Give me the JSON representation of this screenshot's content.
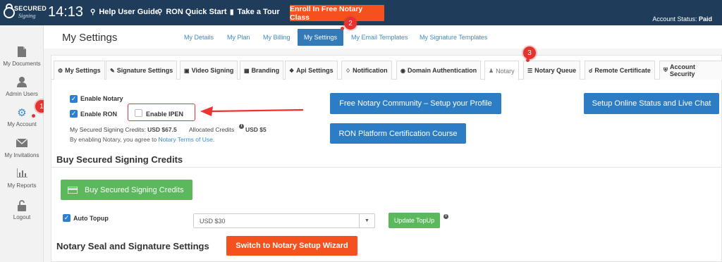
{
  "header": {
    "logo_text": "SECURED",
    "logo_sub": "Signing",
    "clock": "14:13",
    "links": [
      {
        "label": "Help User Guide",
        "icon": "lightbulb-icon"
      },
      {
        "label": "RON Quick Start",
        "icon": "lightbulb-icon"
      },
      {
        "label": "Take a Tour",
        "icon": "book-icon"
      }
    ],
    "enroll_label": "Enroll In Free Notary Class",
    "account_status_label": "Account Status:",
    "account_status_value": "Paid"
  },
  "sidebar": {
    "items": [
      {
        "label": "My Documents",
        "icon": "document-icon"
      },
      {
        "label": "Admin Users",
        "icon": "user-icon"
      },
      {
        "label": "My Account",
        "icon": "gear-icon"
      },
      {
        "label": "My Invitations",
        "icon": "envelope-icon"
      },
      {
        "label": "My Reports",
        "icon": "bar-chart-icon"
      },
      {
        "label": "Logout",
        "icon": "lock-icon"
      }
    ]
  },
  "page": {
    "title": "My Settings",
    "subtabs": [
      "My Details",
      "My Plan",
      "My Billing",
      "My Settings",
      "My Email Templates",
      "My Signature Templates"
    ],
    "active_subtab": "My Settings"
  },
  "tabs": [
    {
      "label": "My Settings",
      "icon": "gear-icon"
    },
    {
      "label": "Signature Settings",
      "icon": "pencil-icon"
    },
    {
      "label": "Video Signing",
      "icon": "video-icon"
    },
    {
      "label": "Branding",
      "icon": "grid-icon"
    },
    {
      "label": "Api Settings",
      "icon": "wrench-icon"
    },
    {
      "label": "Notification",
      "icon": "bell-icon"
    },
    {
      "label": "Domain Authentication",
      "icon": "globe-icon"
    },
    {
      "label": "Notary",
      "icon": "notary-icon"
    },
    {
      "label": "Notary Queue",
      "icon": "list-icon"
    },
    {
      "label": "Remote Certificate",
      "icon": "certificate-icon"
    },
    {
      "label": "Account Security",
      "icon": "shield-icon"
    }
  ],
  "notary": {
    "enable_notary_label": "Enable Notary",
    "enable_ron_label": "Enable RON",
    "enable_ipen_label": "Enable IPEN",
    "credits_label": "My Secured Signing Credits:",
    "credits_value": "USD $67.5",
    "allocated_label": "Allocated Credits",
    "allocated_value": "USD $5",
    "terms_prefix": "By enabling Notary, you agree to",
    "terms_link": "Notary Terms of Use",
    "terms_suffix": ".",
    "community_btn": "Free Notary Community – Setup your Profile",
    "online_status_btn": "Setup Online Status and Live Chat",
    "ron_course_btn": "RON Platform Certification Course"
  },
  "buy_credits": {
    "heading": "Buy Secured Signing Credits",
    "button": "Buy Secured Signing Credits",
    "auto_topup_label": "Auto Topup",
    "topup_amount": "USD $30",
    "update_topup_btn": "Update TopUp"
  },
  "seal": {
    "heading": "Notary Seal and Signature Settings",
    "wizard_btn": "Switch to Notary Setup Wizard"
  },
  "annotations": {
    "step1": "1",
    "step2": "2",
    "step3": "3"
  },
  "colors": {
    "header_bg": "#1f3d5a",
    "accent_orange": "#f4511e",
    "primary_blue": "#2d7dc4",
    "success_green": "#5cb85c",
    "annotation_red": "#e3342f"
  }
}
